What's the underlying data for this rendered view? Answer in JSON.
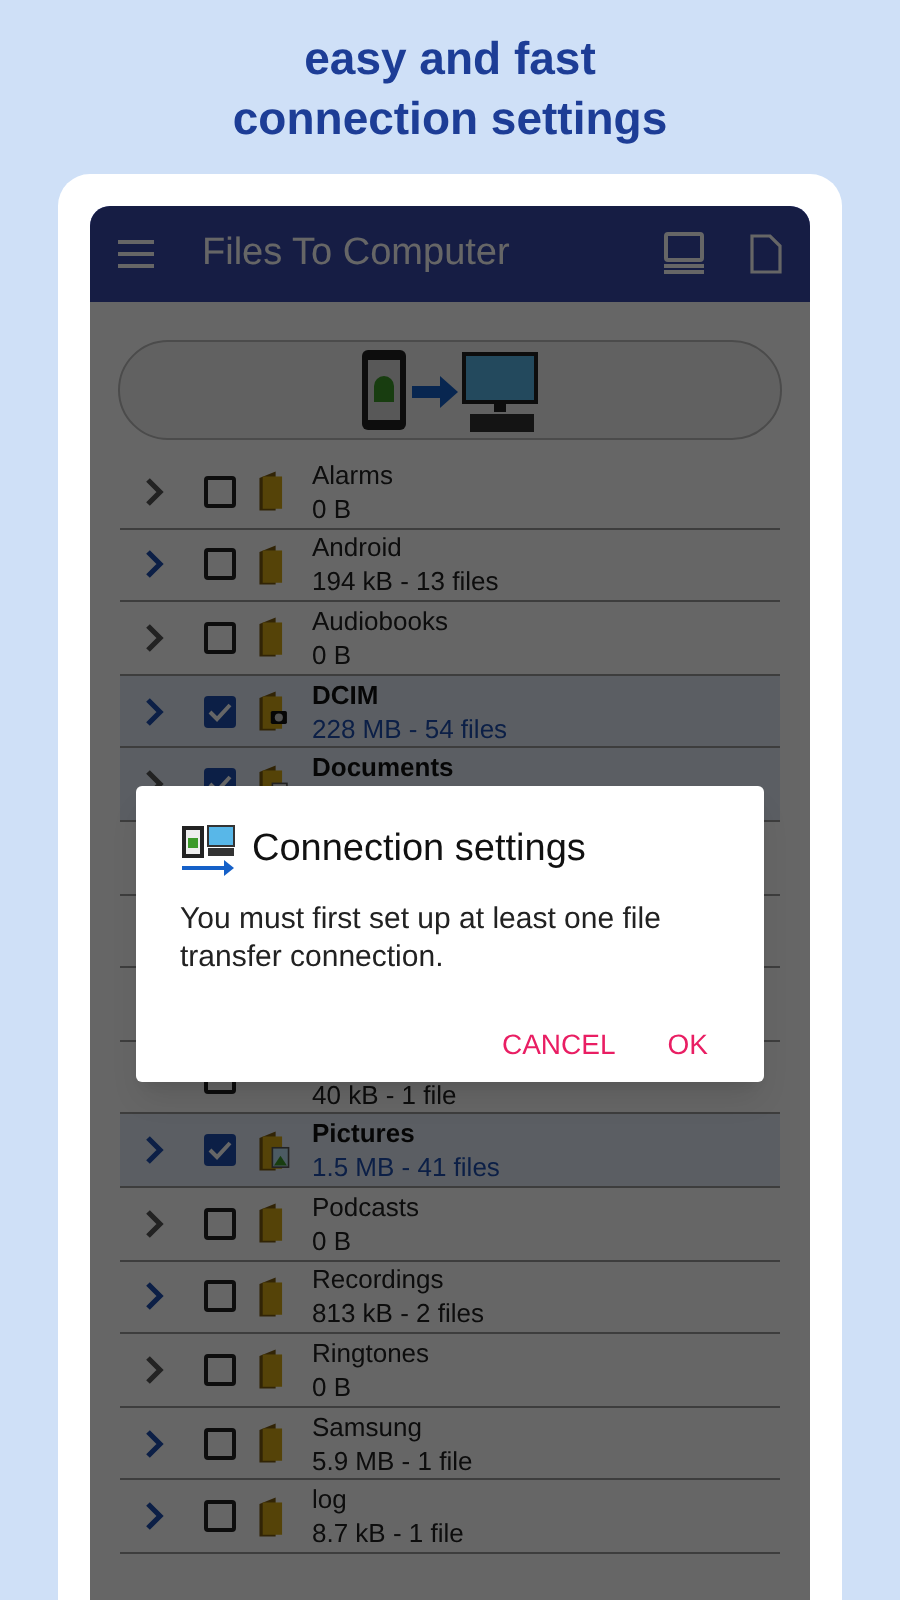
{
  "headline": "easy and fast connection settings",
  "app_bar": {
    "title": "Files To Computer"
  },
  "folders": [
    {
      "kind": "folder",
      "name": "Alarms",
      "info": "0 B",
      "expandable": false,
      "checked": false
    },
    {
      "kind": "folder",
      "name": "Android",
      "info": "194 kB - 13 files",
      "expandable": true,
      "checked": false
    },
    {
      "kind": "folder",
      "name": "Audiobooks",
      "info": "0 B",
      "expandable": false,
      "checked": false
    },
    {
      "kind": "camera-folder",
      "name": "DCIM",
      "info": "228 MB - 54 files",
      "expandable": true,
      "checked": true
    },
    {
      "kind": "document-folder",
      "name": "Documents",
      "expandable": false,
      "checked": true
    },
    {
      "kind": "covered"
    },
    {
      "kind": "covered"
    },
    {
      "kind": "covered"
    },
    {
      "kind": "folder",
      "info": "40 kB - 1 file",
      "checked": false
    },
    {
      "kind": "image-folder",
      "name": "Pictures",
      "info": "1.5 MB - 41 files",
      "expandable": true,
      "checked": true
    },
    {
      "kind": "folder",
      "name": "Podcasts",
      "info": "0 B",
      "expandable": false,
      "checked": false
    },
    {
      "kind": "folder",
      "name": "Recordings",
      "info": "813 kB - 2 files",
      "expandable": true,
      "checked": false
    },
    {
      "kind": "folder",
      "name": "Ringtones",
      "info": "0 B",
      "expandable": false,
      "checked": false
    },
    {
      "kind": "folder",
      "name": "Samsung",
      "info": "5.9 MB - 1 file",
      "expandable": true,
      "checked": false
    },
    {
      "kind": "folder",
      "name": "log",
      "info": "8.7 kB - 1 file",
      "expandable": true,
      "checked": false
    }
  ],
  "dialog": {
    "title": "Connection settings",
    "message": "You must first set up at least one file transfer connection.",
    "buttons": [
      "CANCEL",
      "OK"
    ]
  }
}
